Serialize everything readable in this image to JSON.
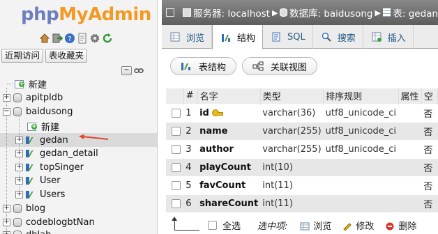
{
  "logo": {
    "php": "php",
    "my": "My",
    "admin": "Admin"
  },
  "nav_icons": [
    "home-icon",
    "exit-icon",
    "help-icon",
    "docs-icon",
    "settings-icon",
    "reload-icon"
  ],
  "nav_buttons": {
    "recent": "近期访问",
    "favorites": "表收藏夹"
  },
  "tree": {
    "new_label": "新建",
    "databases": [
      "apitpldb",
      "baidusong"
    ],
    "baidusong_children": {
      "new_label": "新建",
      "tables": [
        "gedan",
        "gedan_detail",
        "topSinger",
        "User",
        "Users"
      ]
    },
    "more_databases": [
      "blog",
      "codeblogbtNan",
      "dblab"
    ]
  },
  "breadcrumb": {
    "server": "服务器: localhost",
    "database": "数据库: baidusong",
    "table": "表: gedan"
  },
  "tabs": [
    {
      "label": "浏览",
      "icon": "browse-icon",
      "active": false
    },
    {
      "label": "结构",
      "icon": "structure-icon",
      "active": true
    },
    {
      "label": "SQL",
      "icon": "sql-icon",
      "active": false
    },
    {
      "label": "搜索",
      "icon": "search-icon",
      "active": false
    },
    {
      "label": "插入",
      "icon": "insert-icon",
      "active": false
    }
  ],
  "subtabs": {
    "structure": "表结构",
    "relation": "关联视图"
  },
  "table": {
    "headers": {
      "num": "#",
      "name": "名字",
      "type": "类型",
      "collation": "排序规则",
      "attr": "属性",
      "null": "空"
    },
    "rows": [
      {
        "num": "1",
        "name": "id",
        "type": "varchar(36)",
        "collation": "utf8_unicode_ci",
        "attr": "",
        "null": "否",
        "primary": true
      },
      {
        "num": "2",
        "name": "name",
        "type": "varchar(255)",
        "collation": "utf8_unicode_ci",
        "attr": "",
        "null": "否",
        "primary": false
      },
      {
        "num": "3",
        "name": "author",
        "type": "varchar(255)",
        "collation": "utf8_unicode_ci",
        "attr": "",
        "null": "否",
        "primary": false
      },
      {
        "num": "4",
        "name": "playCount",
        "type": "int(10)",
        "collation": "",
        "attr": "",
        "null": "否",
        "primary": false
      },
      {
        "num": "5",
        "name": "favCount",
        "type": "int(11)",
        "collation": "",
        "attr": "",
        "null": "否",
        "primary": false
      },
      {
        "num": "6",
        "name": "shareCount",
        "type": "int(11)",
        "collation": "",
        "attr": "",
        "null": "否",
        "primary": false
      }
    ]
  },
  "bottom": {
    "select_all": "全选",
    "with_selected": "选中项:",
    "browse": "浏览",
    "edit": "修改",
    "drop": "删除"
  },
  "colors": {
    "accent_orange": "#f29a26",
    "php_blue": "#6c7ebd",
    "arrow_red": "#e2432b"
  }
}
